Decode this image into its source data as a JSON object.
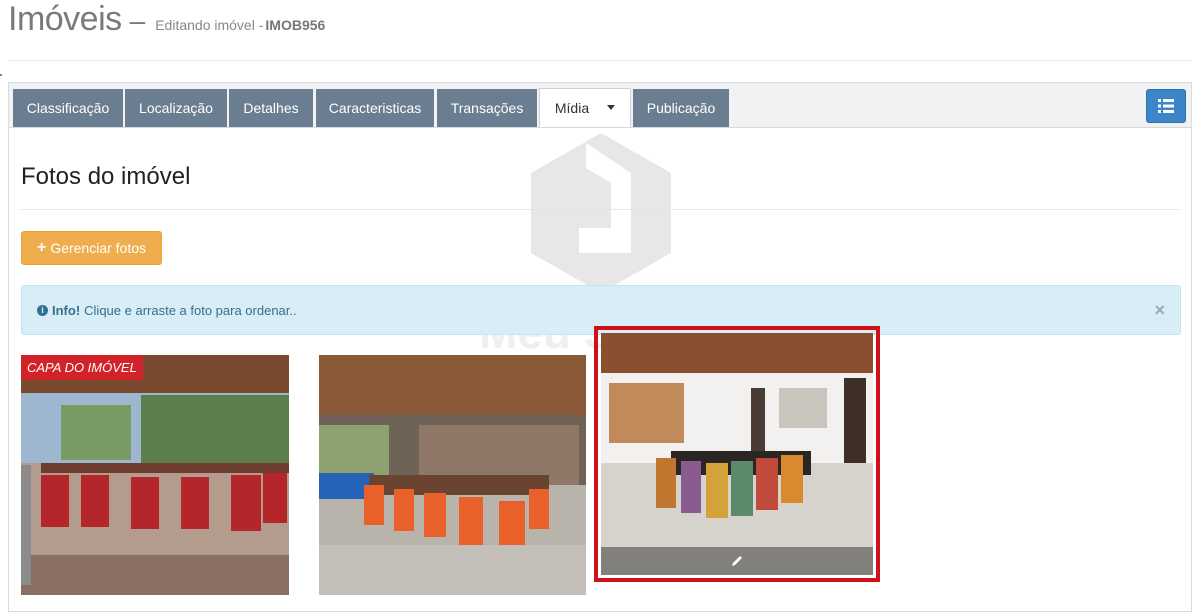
{
  "header": {
    "title": "Imóveis",
    "separator": "–",
    "subtitle": "Editando imóvel -",
    "code": "IMOB956"
  },
  "tabs": [
    {
      "label": "Classificação",
      "active": false
    },
    {
      "label": "Localização",
      "active": false
    },
    {
      "label": "Detalhes",
      "active": false
    },
    {
      "label": "Caracteristicas",
      "active": false
    },
    {
      "label": "Transações",
      "active": false
    },
    {
      "label": "Mídia",
      "active": true,
      "has_dropdown": true
    },
    {
      "label": "Publicação",
      "active": false
    }
  ],
  "list_button_icon": "list-icon",
  "section": {
    "title": "Fotos do imóvel",
    "manage_button": {
      "icon": "plus-icon",
      "label": "Gerenciar fotos"
    }
  },
  "alert": {
    "icon": "info-icon",
    "strong": "Info!",
    "message": "Clique e arraste a foto para ordenar..",
    "close": "×"
  },
  "photos": [
    {
      "badge": "CAPA DO IMÓVEL",
      "alt": "photo-1"
    },
    {
      "alt": "photo-2"
    },
    {
      "alt": "photo-3",
      "selected": true,
      "edit_icon": "pencil-icon"
    }
  ],
  "watermark_text": "Meu Site",
  "colors": {
    "tab_bg": "#6b7e91",
    "primary": "#3a86c8",
    "warning": "#f0ad4e",
    "info_bg": "#d9edf7",
    "badge": "#d2232a",
    "selection": "#d0101a"
  }
}
